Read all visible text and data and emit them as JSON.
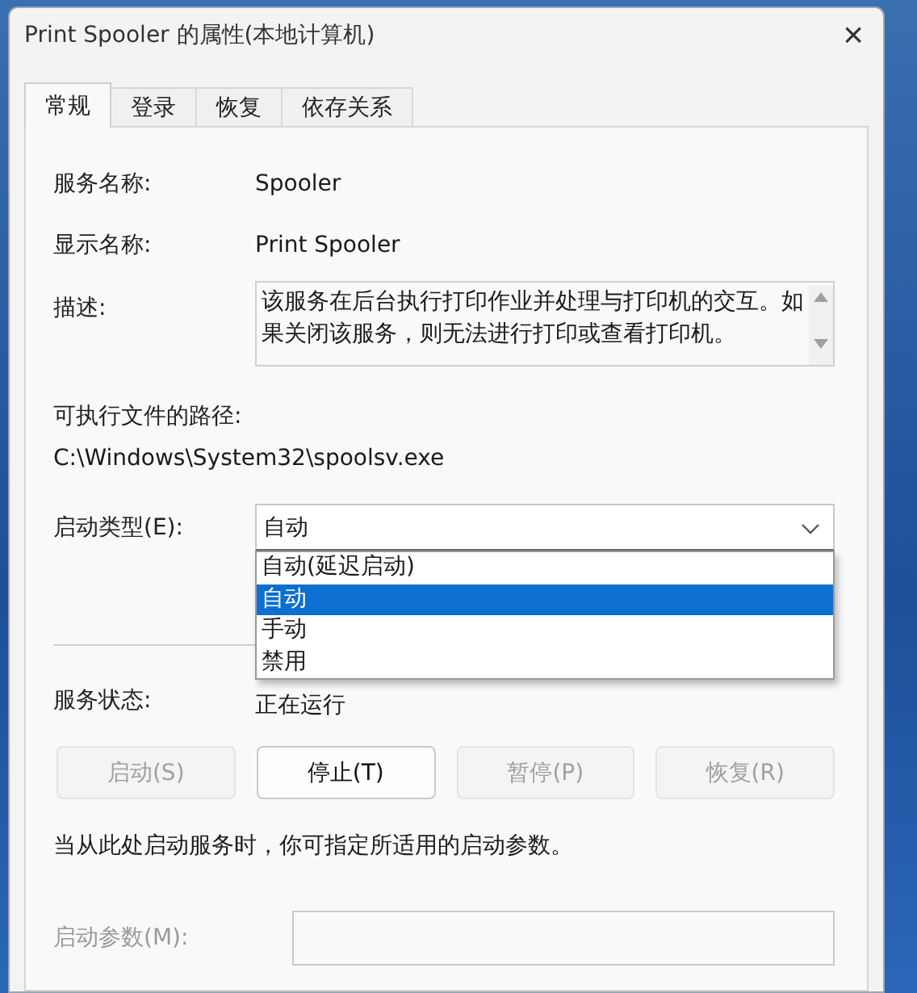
{
  "window": {
    "title": "Print Spooler 的属性(本地计算机)",
    "close": "×"
  },
  "tabs": [
    {
      "label": "常规",
      "selected": true
    },
    {
      "label": "登录",
      "selected": false
    },
    {
      "label": "恢复",
      "selected": false
    },
    {
      "label": "依存关系",
      "selected": false
    }
  ],
  "service_name": {
    "label": "服务名称:",
    "value": "Spooler"
  },
  "display_name": {
    "label": "显示名称:",
    "value": "Print Spooler"
  },
  "description": {
    "label": "描述:",
    "value": "该服务在后台执行打印作业并处理与打印机的交互。如果关闭该服务，则无法进行打印或查看打印机。"
  },
  "executable_path": {
    "label": "可执行文件的路径:",
    "value": "C:\\Windows\\System32\\spoolsv.exe"
  },
  "startup_type": {
    "label": "启动类型(E):",
    "value": "自动",
    "expanded": true,
    "options": [
      {
        "label": "自动(延迟启动)",
        "selected": false
      },
      {
        "label": "自动",
        "selected": true
      },
      {
        "label": "手动",
        "selected": false
      },
      {
        "label": "禁用",
        "selected": false
      }
    ]
  },
  "service_status": {
    "label": "服务状态:",
    "value": "正在运行"
  },
  "buttons": [
    {
      "label": "启动(S)",
      "disabled": true
    },
    {
      "label": "停止(T)",
      "disabled": false
    },
    {
      "label": "暂停(P)",
      "disabled": true
    },
    {
      "label": "恢复(R)",
      "disabled": true
    }
  ],
  "hint": "当从此处启动服务时，你可指定所适用的启动参数。",
  "start_parameters": {
    "label": "启动参数(M):",
    "disabled": true
  }
}
